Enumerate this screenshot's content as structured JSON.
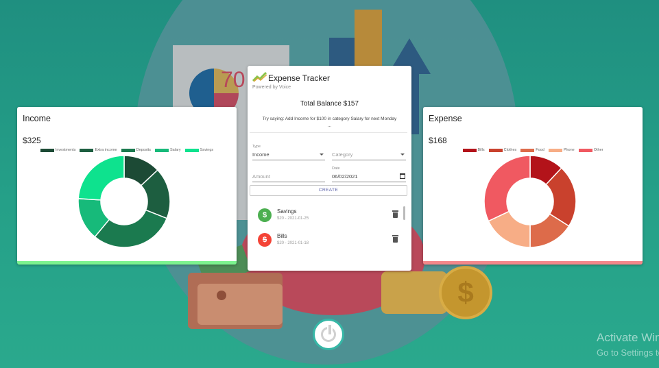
{
  "background": {
    "illustration_text": "70"
  },
  "income": {
    "title": "Income",
    "amount": "$325",
    "accent": "#7cf38f",
    "legend": [
      "Investments",
      "Extra income",
      "Deposits",
      "Salary",
      "Savings"
    ]
  },
  "expense": {
    "title": "Expense",
    "amount": "$168",
    "accent": "#f3878a",
    "legend": [
      "Bills",
      "Clothes",
      "Food",
      "Phone",
      "Other"
    ]
  },
  "chart_data": [
    {
      "type": "pie",
      "title": "Income",
      "categories": [
        "Investments",
        "Extra income",
        "Deposits",
        "Salary",
        "Savings"
      ],
      "values": [
        13,
        18,
        30,
        15,
        24
      ],
      "colors": [
        "#1c4a35",
        "#1d5e40",
        "#1b7a4f",
        "#17ba7a",
        "#0ee28e"
      ]
    },
    {
      "type": "pie",
      "title": "Expense",
      "categories": [
        "Bills",
        "Clothes",
        "Food",
        "Phone",
        "Other"
      ],
      "values": [
        12,
        22,
        16,
        18,
        32
      ],
      "colors": [
        "#b3131a",
        "#c9412d",
        "#dd6b4a",
        "#f7ad86",
        "#f05961"
      ]
    }
  ],
  "tracker": {
    "title": "Expense Tracker",
    "subtitle": "Powered by Voice",
    "balance": "Total Balance $157",
    "hint": "Try saying: Add Income for $100 in category Salary for next Monday ...",
    "type_label": "Type",
    "type_value": "Income",
    "category_placeholder": "Category",
    "amount_placeholder": "Amount",
    "date_label": "Date",
    "date_value": "06/02/2021",
    "create_label": "CREATE",
    "transactions": [
      {
        "name": "Savings",
        "meta": "$20 - 2021-01-25",
        "icon": "dollar-icon",
        "color": "#4caf50"
      },
      {
        "name": "Bills",
        "meta": "$20 - 2021-01-18",
        "icon": "dollar-off-icon",
        "color": "#f44336"
      }
    ]
  },
  "watermark": {
    "line1": "Activate Windows",
    "line2": "Go to Settings to activate Windows."
  }
}
